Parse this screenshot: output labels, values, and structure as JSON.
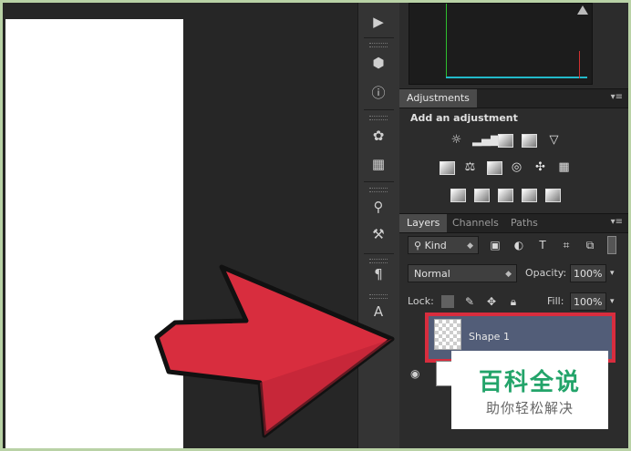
{
  "adjustments": {
    "tab_label": "Adjustments",
    "add_label": "Add an adjustment"
  },
  "layers": {
    "tabs": [
      "Layers",
      "Channels",
      "Paths"
    ],
    "filter_kind": "Kind",
    "blend_mode": "Normal",
    "opacity_label": "Opacity:",
    "opacity_value": "100%",
    "lock_label": "Lock:",
    "fill_label": "Fill:",
    "fill_value": "100%",
    "items": [
      {
        "name": "Shape 1",
        "selected": true
      },
      {
        "name": "",
        "selected": false
      }
    ]
  },
  "toolbar_icons": [
    "play-icon",
    "3d-icon",
    "info-icon",
    "palette-icon",
    "grid-icon",
    "brushes-icon",
    "tool-presets-icon",
    "paragraph-icon",
    "character-icon"
  ],
  "watermark": {
    "title": "百科全说",
    "subtitle": "助你轻松解决"
  },
  "colors": {
    "highlight": "#d82d3e",
    "arrow": "#d82d3e",
    "selected_layer": "#525d78",
    "watermark_green": "#23a46a"
  }
}
